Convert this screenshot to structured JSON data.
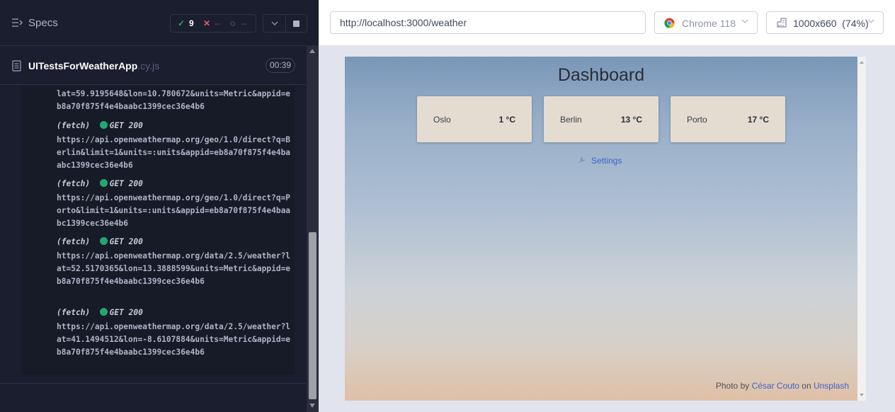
{
  "runner": {
    "specs_label": "Specs",
    "stats": {
      "passed": "9",
      "failed": "--",
      "pending": "--"
    },
    "spec_name": "UITestsForWeatherApp",
    "spec_ext": ".cy.js",
    "duration": "00:39"
  },
  "log": {
    "first_text": "lat=59.9195648&lon=10.780672&units=Metric&appid=eb8a70f875f4e4baabc1399cec36e4b6",
    "entries": [
      {
        "type": "(fetch)",
        "method": "GET",
        "status": "200",
        "url": "https://api.openweathermap.org/geo/1.0/direct?q=Berlin&limit=1&units=:units&appid=eb8a70f875f4e4baabc1399cec36e4b6"
      },
      {
        "type": "(fetch)",
        "method": "GET",
        "status": "200",
        "url": "https://api.openweathermap.org/geo/1.0/direct?q=Porto&limit=1&units=:units&appid=eb8a70f875f4e4baabc1399cec36e4b6"
      },
      {
        "type": "(fetch)",
        "method": "GET",
        "status": "200",
        "url": "https://api.openweathermap.org/data/2.5/weather?lat=52.5170365&lon=13.3888599&units=Metric&appid=eb8a70f875f4e4baabc1399cec36e4b6"
      },
      {
        "type": "(fetch)",
        "method": "GET",
        "status": "200",
        "url": "https://api.openweathermap.org/data/2.5/weather?lat=41.1494512&lon=-8.6107884&units=Metric&appid=eb8a70f875f4e4baabc1399cec36e4b6"
      }
    ]
  },
  "browser": {
    "url": "http://localhost:3000/weather",
    "browser_name": "Chrome 118",
    "viewport": "1000x660  (74%)"
  },
  "app": {
    "title": "Dashboard",
    "cards": [
      {
        "city": "Oslo",
        "temp": "1 °C"
      },
      {
        "city": "Berlin",
        "temp": "13 °C"
      },
      {
        "city": "Porto",
        "temp": "17 °C"
      }
    ],
    "settings_label": "Settings",
    "credit": {
      "prefix": "Photo by ",
      "author": "César Couto",
      "middle": " on ",
      "site": "Unsplash"
    }
  },
  "colors": {
    "pass": "#1fa971",
    "fail": "#e45770",
    "link": "#3f62c9",
    "card": "#e4dcd0"
  },
  "icons": [
    "specs-icon",
    "check-icon",
    "x-icon",
    "spinner-icon",
    "chevron-down-icon",
    "stop-icon",
    "file-icon",
    "chrome-icon",
    "ruler-icon",
    "settings-icon"
  ]
}
